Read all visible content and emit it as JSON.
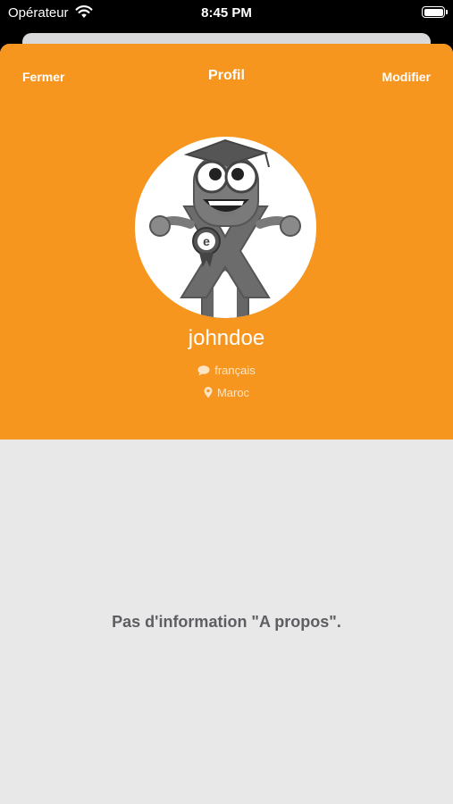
{
  "status_bar": {
    "carrier": "Opérateur",
    "time": "8:45 PM",
    "icons": [
      "wifi-icon",
      "battery-icon"
    ]
  },
  "nav": {
    "close_label": "Fermer",
    "title": "Profil",
    "edit_label": "Modifier"
  },
  "profile": {
    "username": "johndoe",
    "language": "français",
    "location": "Maroc",
    "avatar_icon": "mascot-avatar"
  },
  "about": {
    "empty_message": "Pas d'information \"A propos\"."
  },
  "colors": {
    "header": "#f7961e",
    "content_background": "#e9e8e9",
    "empty_text": "#5e5e62"
  }
}
